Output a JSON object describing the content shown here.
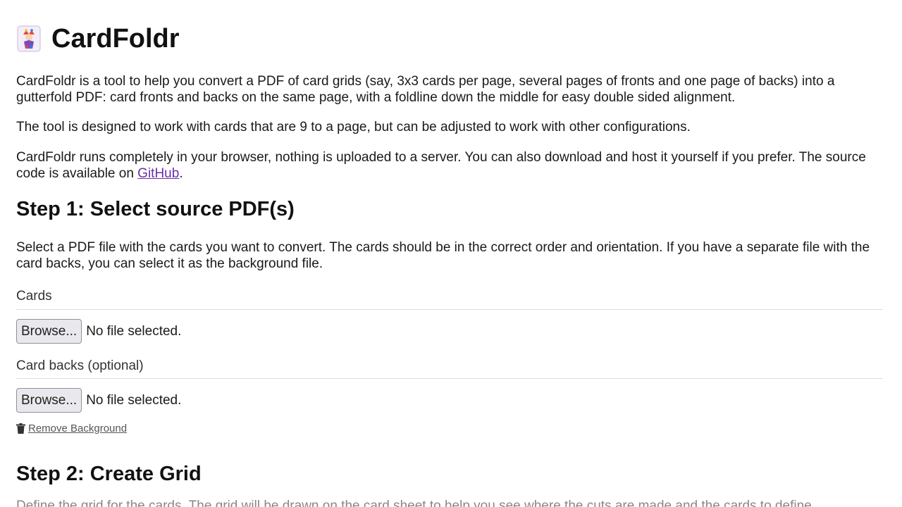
{
  "header": {
    "title": "CardFoldr",
    "logo_icon": "joker-card-icon"
  },
  "intro": {
    "p1": "CardFoldr is a tool to help you convert a PDF of card grids (say, 3x3 cards per page, several pages of fronts and one page of backs) into a gutterfold PDF: card fronts and backs on the same page, with a foldline down the middle for easy double sided alignment.",
    "p2": "The tool is designed to work with cards that are 9 to a page, but can be adjusted to work with other configurations.",
    "p3_before": "CardFoldr runs completely in your browser, nothing is uploaded to a server. You can also download and host it yourself if you prefer. The source code is available on ",
    "p3_link": "GitHub",
    "p3_after": "."
  },
  "step1": {
    "heading": "Step 1: Select source PDF(s)",
    "description": "Select a PDF file with the cards you want to convert. The cards should be in the correct order and orientation. If you have a separate file with the card backs, you can select it as the background file.",
    "cards_label": "Cards",
    "cards_browse": "Browse...",
    "cards_status": "No file selected.",
    "backs_label": "Card backs (optional)",
    "backs_browse": "Browse...",
    "backs_status": "No file selected.",
    "remove_background": " Remove Background",
    "remove_icon": "trash-icon"
  },
  "step2": {
    "heading": "Step 2: Create Grid",
    "description": "Define the grid for the cards. The grid will be drawn on the card sheet to help you see where the cuts are made and the cards to define."
  },
  "colors": {
    "link": "#6b2fa7",
    "rule": "#dddddd",
    "button_bg": "#e9e9ed"
  }
}
